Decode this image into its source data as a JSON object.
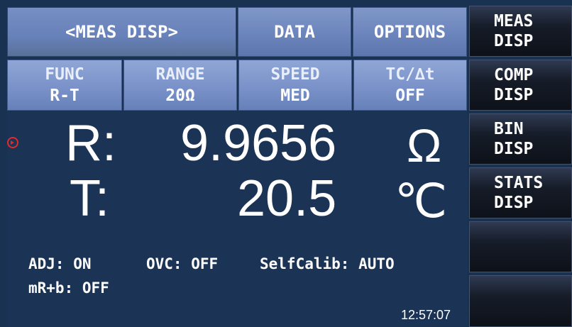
{
  "tabs": [
    {
      "label": "<MEAS DISP>"
    },
    {
      "label": "DATA"
    },
    {
      "label": "OPTIONS"
    }
  ],
  "params": [
    {
      "label": "FUNC",
      "value": "R-T"
    },
    {
      "label": "RANGE",
      "value": "20Ω"
    },
    {
      "label": "SPEED",
      "value": "MED"
    },
    {
      "label": "TC/∆t",
      "value": "OFF"
    }
  ],
  "softkeys": [
    {
      "line1": "MEAS",
      "line2": "DISP"
    },
    {
      "line1": "COMP",
      "line2": "DISP"
    },
    {
      "line1": "BIN",
      "line2": "DISP"
    },
    {
      "line1": "STATS",
      "line2": "DISP"
    },
    {
      "line1": "",
      "line2": ""
    },
    {
      "line1": "",
      "line2": ""
    }
  ],
  "readings": {
    "r_label": "R:",
    "r_value": "9.9656",
    "r_unit": "Ω",
    "t_label": "T:",
    "t_value": "20.5",
    "t_unit": "℃"
  },
  "status": {
    "adj": "ADJ: ON",
    "ovc": "OVC: OFF",
    "selfcalib": "SelfCalib: AUTO",
    "mrb": "mR+b: OFF"
  },
  "clock": "12:57:07",
  "colors": {
    "background": "#1a3252",
    "tab": "#6d86bd",
    "softkey": "#161c28",
    "trigger": "#e22a2a"
  },
  "icons": {
    "trigger": "trigger-indicator-icon"
  }
}
